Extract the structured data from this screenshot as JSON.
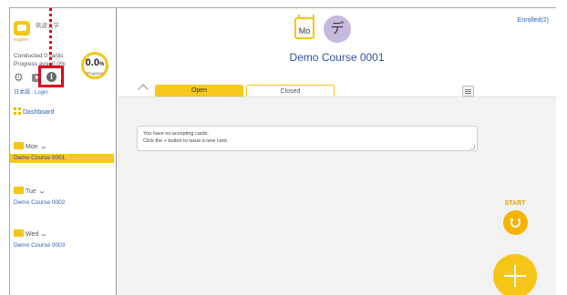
{
  "sidebar": {
    "logo_text": "eugien",
    "university_name": "筑波大学",
    "conducted_text": "Conducted 0 cards",
    "progress_text": "Progress avg. 0.0%",
    "progress_value": "0.0",
    "progress_unit": "%",
    "progress_label": "Progress",
    "language_link": "日本語 : Login",
    "dashboard_label": "Dashboard",
    "days": [
      {
        "label": "Mon",
        "course": "Demo Course 0001",
        "active": true
      },
      {
        "label": "Tue",
        "course": "Demo Course 0002",
        "active": false
      },
      {
        "label": "Wed",
        "course": "Demo Course 0003",
        "active": false
      }
    ]
  },
  "header": {
    "day_badge": "Mo",
    "avatar_char": "デ",
    "enrolled_label": "Enrolled(2)",
    "course_title": "Demo Course 0001"
  },
  "tabs": [
    {
      "label": "Open",
      "active": true
    },
    {
      "label": "Closed",
      "active": false
    }
  ],
  "notice": {
    "line1": "You have no accepting cards.",
    "line2": "Click the + button to issue a new card."
  },
  "start_label": "START",
  "icons": {
    "gear": "gear-icon",
    "video": "video-icon",
    "info": "info-icon",
    "dashboard": "dashboard-icon",
    "folder": "folder-icon",
    "chevron": "chevron-down-icon",
    "menu": "menu-icon",
    "smile": "smile-icon",
    "plus": "plus-icon"
  },
  "colors": {
    "accent": "#f5c518",
    "highlight": "#e0001b",
    "link": "#2b5fae",
    "avatar_bg": "#c7b8dd"
  }
}
